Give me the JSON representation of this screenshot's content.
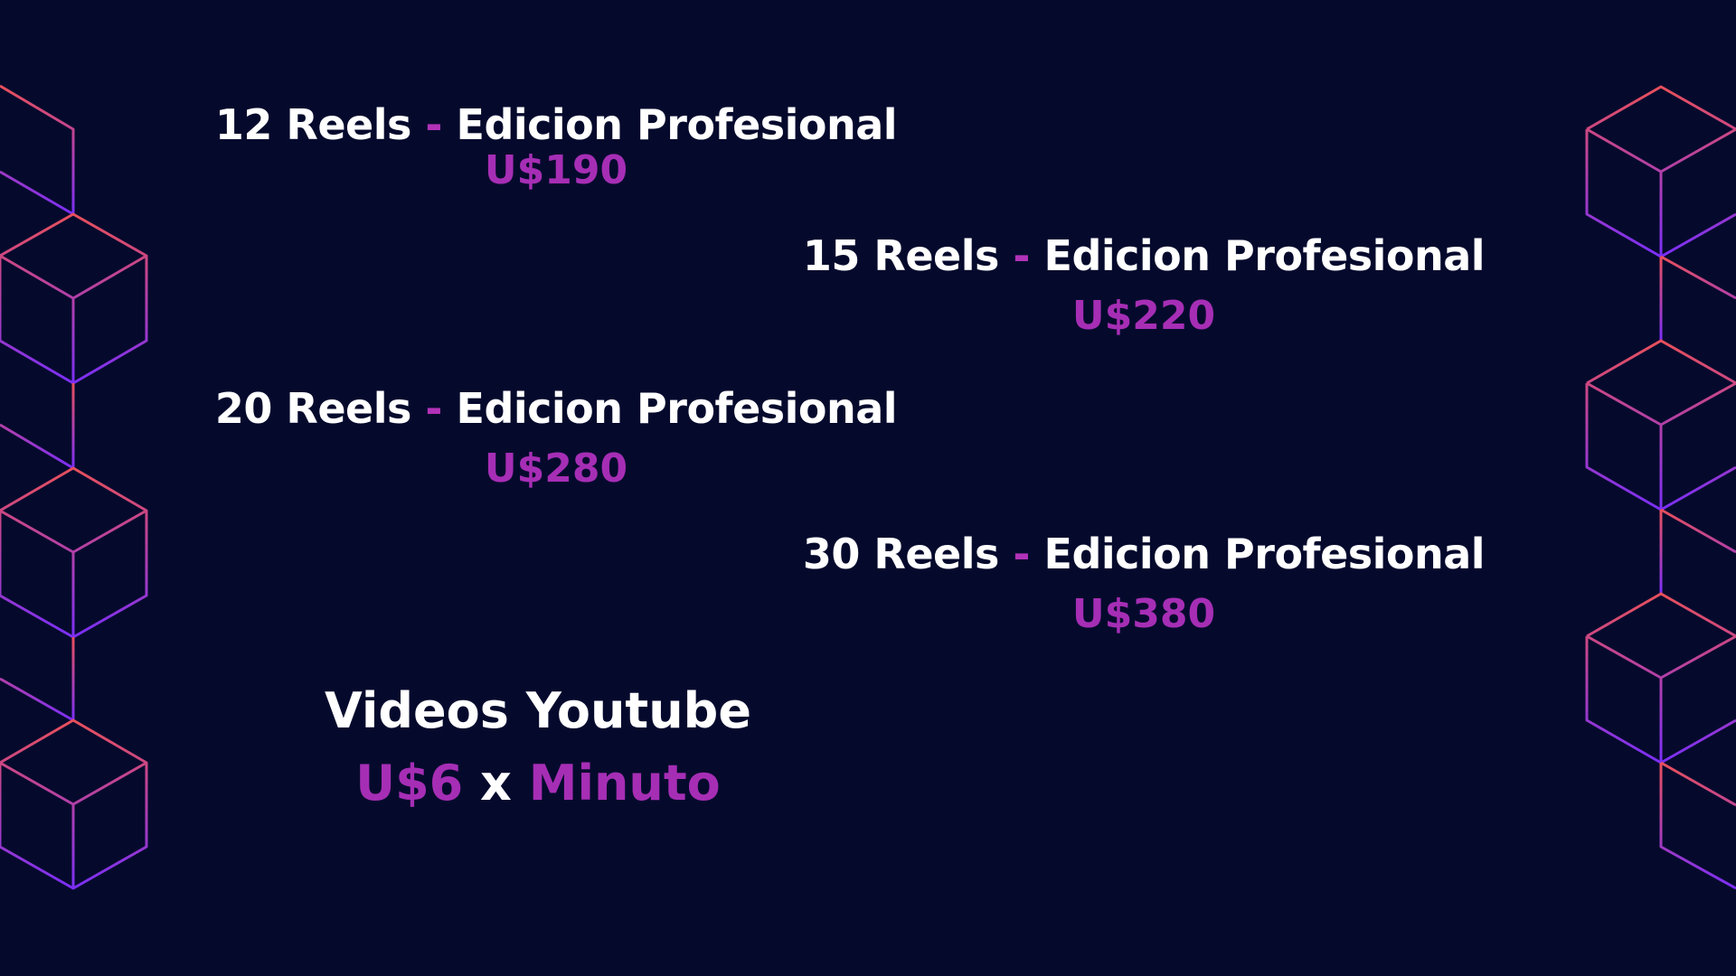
{
  "colors": {
    "background": "#050a2d",
    "accent": "#a62eb5",
    "text": "#ffffff",
    "line_top": "#e8505b",
    "line_bottom": "#7b2ff7"
  },
  "offers": [
    {
      "qty": "12 Reels",
      "sep": "-",
      "service": "Edicion Profesional",
      "price": "U$190"
    },
    {
      "qty": "15 Reels",
      "sep": "-",
      "service": "Edicion Profesional",
      "price": "U$220"
    },
    {
      "qty": "20 Reels",
      "sep": "-",
      "service": "Edicion Profesional",
      "price": "U$280"
    },
    {
      "qty": "30 Reels",
      "sep": "-",
      "service": "Edicion Profesional",
      "price": "U$380"
    }
  ],
  "youtube": {
    "title": "Videos Youtube",
    "price": "U$6",
    "mult": "x",
    "unit": "Minuto"
  }
}
